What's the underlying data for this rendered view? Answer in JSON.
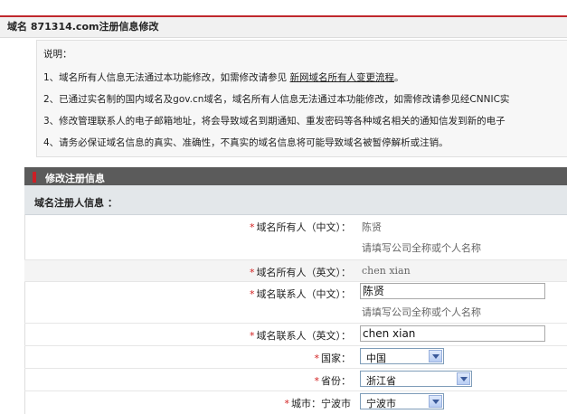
{
  "page": {
    "title": "域名  871314.com注册信息修改"
  },
  "notice": {
    "heading": "说明：",
    "lines": [
      {
        "prefix": "1、域名所有人信息无法通过本功能修改，如需修改请参见  ",
        "link": "新网域名所有人变更流程",
        "suffix": "。"
      },
      {
        "text": "2、已通过实名制的国内域名及gov.cn域名，域名所有人信息无法通过本功能修改，如需修改请参见经CNNIC实"
      },
      {
        "text": "3、修改管理联系人的电子邮箱地址，将会导致域名到期通知、重发密码等各种域名相关的通知信发到新的电子"
      },
      {
        "text": "4、请务必保证域名信息的真实、准确性，不真实的域名信息将可能导致域名被暂停解析或注销。"
      }
    ]
  },
  "section": {
    "title": "修改注册信息",
    "subtitle": "域名注册人信息 ："
  },
  "fields": {
    "owner_cn": {
      "label": "域名所有人（中文）：",
      "value": "陈贤",
      "hint": "请填写公司全称或个人名称"
    },
    "owner_en": {
      "label": "域名所有人（英文）：",
      "value": "chen xian"
    },
    "contact_cn": {
      "label": "域名联系人（中文）：",
      "value": "陈贤",
      "hint": "请填写公司全称或个人名称"
    },
    "contact_en": {
      "label": "域名联系人（英文）：",
      "value": "chen xian"
    },
    "country": {
      "label": "国家：",
      "value": "中国"
    },
    "province": {
      "label": "省份：",
      "value": "浙江省"
    },
    "city": {
      "label": "城市：宁波市",
      "value": "宁波市"
    }
  },
  "required_mark": "*",
  "colors": {
    "accent_red": "#c0282d",
    "section_header_bg": "#5b5b5b",
    "required": "#d21f1f"
  }
}
